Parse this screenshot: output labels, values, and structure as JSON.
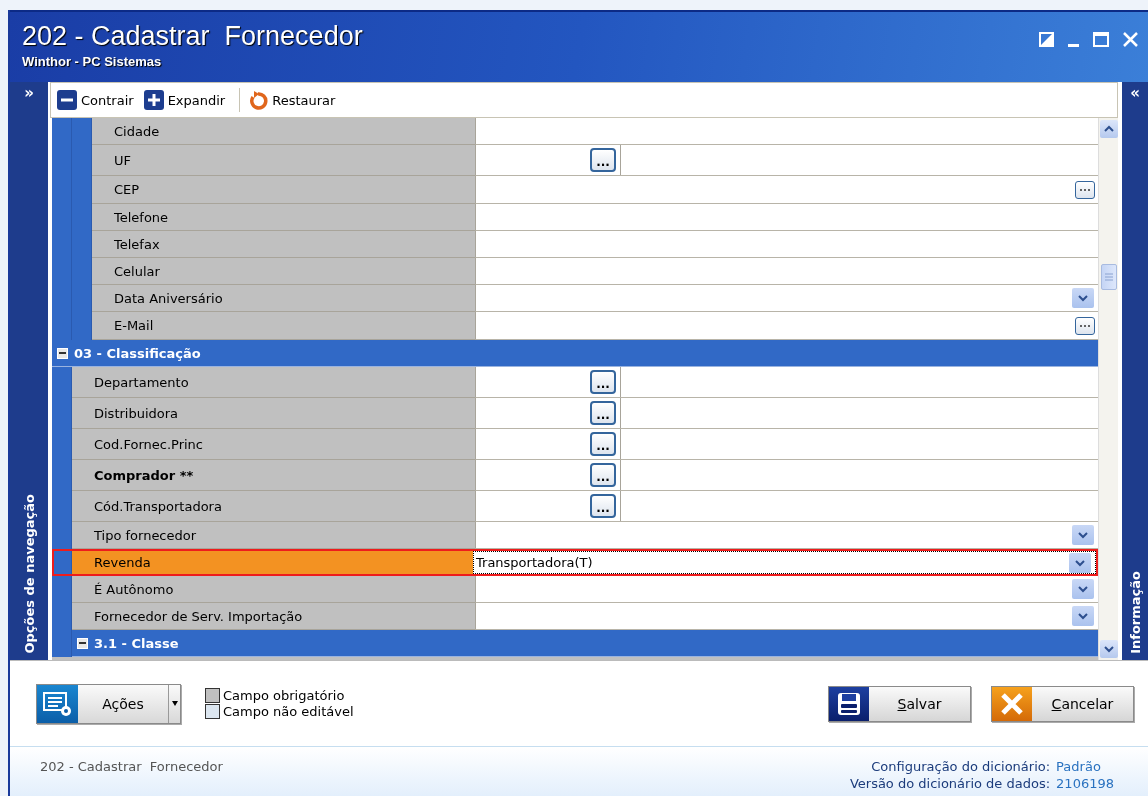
{
  "window": {
    "title": "202 - Cadastrar  Fornecedor",
    "subtitle": "Winthor - PC Sistemas"
  },
  "nav_panel": {
    "toggle": "»",
    "label": "Opções de navegação"
  },
  "info_panel": {
    "toggle": "«",
    "label": "Informação"
  },
  "toolbar": [
    {
      "label": "Contrair",
      "kind": "collapse"
    },
    {
      "label": "Expandir",
      "kind": "expand"
    },
    {
      "label": "Restaurar",
      "kind": "restore"
    }
  ],
  "fields": [
    {
      "kind": "group-continued",
      "children": [
        {
          "kind": "group-continued",
          "children": [
            {
              "kind": "text",
              "label": "Cidade",
              "required": false,
              "selected": false
            },
            {
              "kind": "lookup",
              "label": "UF",
              "button": "...",
              "required": false,
              "selected": false
            },
            {
              "kind": "dialog",
              "label": "CEP",
              "required": false,
              "selected": false
            },
            {
              "kind": "text",
              "label": "Telefone",
              "required": false,
              "selected": false
            },
            {
              "kind": "text",
              "label": "Telefax",
              "required": false,
              "selected": false
            },
            {
              "kind": "text",
              "label": "Celular",
              "required": false,
              "selected": false
            },
            {
              "kind": "combo",
              "label": "Data Aniversário",
              "required": false,
              "selected": false
            },
            {
              "kind": "dialog",
              "label": "E-Mail",
              "required": false,
              "selected": false
            }
          ]
        }
      ]
    },
    {
      "kind": "group",
      "title": "03 - Classificação",
      "expanded": true,
      "children": [
        {
          "kind": "lookup",
          "label": "Departamento",
          "button": "...",
          "required": false,
          "selected": false
        },
        {
          "kind": "lookup",
          "label": "Distribuidora",
          "button": "...",
          "required": false,
          "selected": false
        },
        {
          "kind": "lookup",
          "label": "Cod.Fornec.Princ",
          "button": "...",
          "required": false,
          "selected": false
        },
        {
          "kind": "lookup",
          "label": "Comprador **",
          "button": "...",
          "required": true,
          "selected": false
        },
        {
          "kind": "lookup",
          "label": "Cód.Transportadora",
          "button": "...",
          "required": false,
          "selected": false
        },
        {
          "kind": "combo",
          "label": "Tipo fornecedor",
          "required": false,
          "selected": false
        },
        {
          "kind": "combo",
          "label": "Revenda",
          "value": "Transportadora(T)",
          "required": false,
          "selected": true
        },
        {
          "kind": "combo",
          "label": "É Autônomo",
          "required": false,
          "selected": false
        },
        {
          "kind": "combo",
          "label": "Fornecedor de Serv. Importação",
          "required": false,
          "selected": false
        },
        {
          "kind": "group",
          "title": "3.1 - Classe",
          "expanded": true
        }
      ]
    }
  ],
  "actions_button": {
    "label": "Ações"
  },
  "legend": [
    {
      "label": "Campo obrigatório",
      "kind": "required"
    },
    {
      "label": "Campo não editável",
      "kind": "readonly"
    }
  ],
  "buttons": [
    {
      "label": "Salvar",
      "kind": "save"
    },
    {
      "label": "Cancelar",
      "kind": "cancel"
    }
  ],
  "status_bar": {
    "screen": "202 - Cadastrar  Fornecedor",
    "dictionary_config_label": "Configuração do dicionário:",
    "dictionary_config": "Padrão",
    "data_version_label": "Versão do dicionário de dados:",
    "data_version": "2106198"
  }
}
